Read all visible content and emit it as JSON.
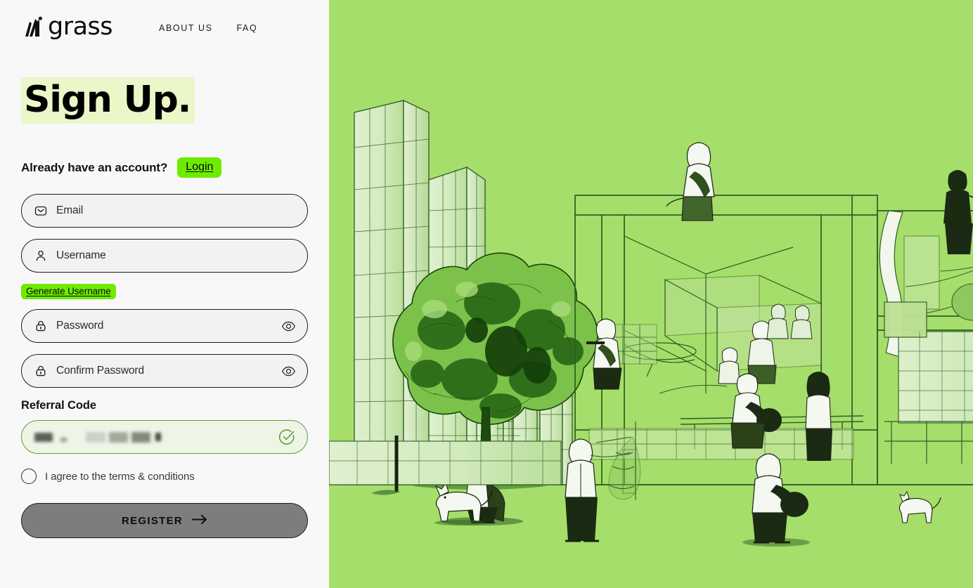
{
  "brand": {
    "name": "grass",
    "logo_icon": "grass-bars-logo-icon"
  },
  "nav": {
    "items": [
      {
        "label": "ABOUT US",
        "name": "nav-about-us"
      },
      {
        "label": "FAQ",
        "name": "nav-faq"
      }
    ]
  },
  "page": {
    "title": "Sign Up.",
    "title_highlight_color": "#eaf7c8"
  },
  "account": {
    "prompt": "Already have an account?",
    "login_label": "Login",
    "login_bg": "#6dec00"
  },
  "form": {
    "email": {
      "placeholder": "Email",
      "value": "",
      "icon": "envelope-icon"
    },
    "username": {
      "placeholder": "Username",
      "value": "",
      "icon": "user-icon"
    },
    "generate_username_label": "Generate Username",
    "password": {
      "placeholder": "Password",
      "value": "",
      "icon": "lock-icon",
      "toggle_icon": "eye-icon"
    },
    "confirm_password": {
      "placeholder": "Confirm Password",
      "value": "",
      "icon": "lock-icon",
      "toggle_icon": "eye-icon"
    },
    "referral": {
      "label": "Referral Code",
      "value": "",
      "redacted": true,
      "status_icon": "check-circle-icon",
      "border_color": "#5f9e3c",
      "background_color": "#eef5e6"
    },
    "terms": {
      "label": "I agree to the terms & conditions",
      "checked": false
    },
    "submit": {
      "label": "REGISTER",
      "icon": "arrow-right-icon",
      "disabled": true,
      "background": "#7d7d7d"
    }
  },
  "illustration": {
    "name": "city-scaffolding-line-art",
    "background_color": "#a5de6b",
    "line_color": "#2f5d22"
  }
}
